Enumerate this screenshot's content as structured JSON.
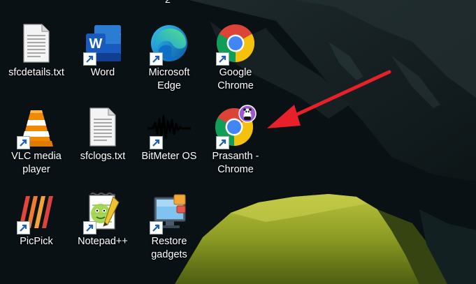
{
  "desktop": {
    "top_fragment": "2",
    "icons": [
      {
        "label": "sfcdetails.txt",
        "icon": "text-document-icon",
        "shortcut": false
      },
      {
        "label": "Word",
        "icon": "word-icon",
        "shortcut": true
      },
      {
        "label": "Microsoft Edge",
        "icon": "edge-icon",
        "shortcut": true
      },
      {
        "label": "Google Chrome",
        "icon": "chrome-icon",
        "shortcut": true
      },
      {
        "label": "VLC media player",
        "icon": "vlc-icon",
        "shortcut": true
      },
      {
        "label": "sfclogs.txt",
        "icon": "text-document-icon",
        "shortcut": false
      },
      {
        "label": "BitMeter OS",
        "icon": "bitmeter-icon",
        "shortcut": true
      },
      {
        "label": "Prasanth - Chrome",
        "icon": "chrome-profile-icon",
        "shortcut": true
      },
      {
        "label": "PicPick",
        "icon": "picpick-icon",
        "shortcut": true
      },
      {
        "label": "Notepad++",
        "icon": "notepad-plus-plus-icon",
        "shortcut": true
      },
      {
        "label": "Restore gadgets",
        "icon": "restore-gadgets-icon",
        "shortcut": true
      }
    ]
  },
  "colors": {
    "annotation_arrow": "#e8202a",
    "chrome_red": "#db4437",
    "chrome_yellow": "#f4c20d",
    "chrome_green": "#0f9d58",
    "chrome_blue": "#4285f4",
    "word_blue": "#185abd",
    "vlc_orange": "#f08a00"
  }
}
